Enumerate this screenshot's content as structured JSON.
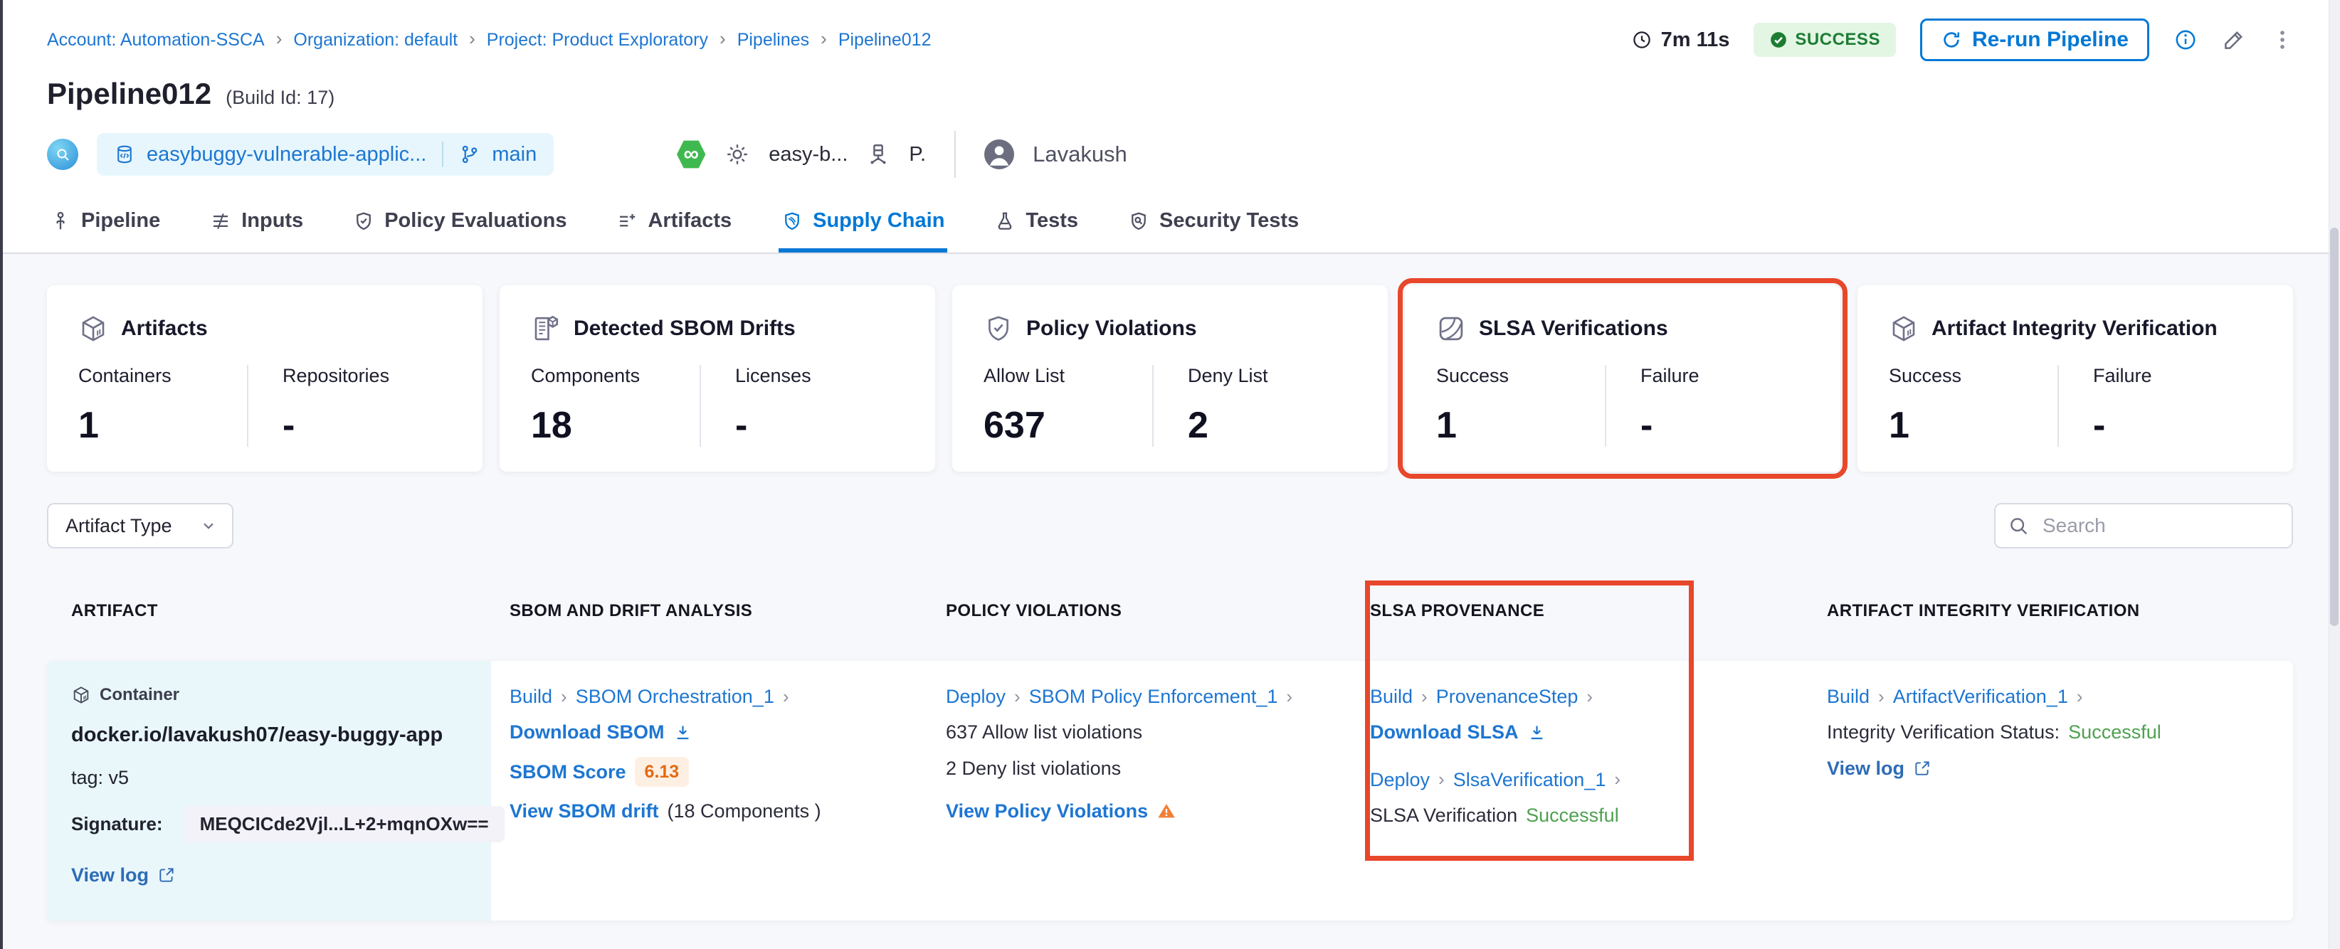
{
  "breadcrumb": {
    "items": [
      "Account: Automation-SSCA",
      "Organization: default",
      "Project: Product Exploratory",
      "Pipelines",
      "Pipeline012"
    ]
  },
  "topbar": {
    "duration": "7m 11s",
    "status": "SUCCESS",
    "rerun_label": "Re-run Pipeline"
  },
  "header": {
    "title": "Pipeline012",
    "build_id": "(Build Id: 17)",
    "repo_name": "easybuggy-vulnerable-applic...",
    "branch": "main",
    "trigger_name": "easy-b...",
    "env_short": "P.",
    "user": "Lavakush"
  },
  "tabs": [
    {
      "label": "Pipeline"
    },
    {
      "label": "Inputs"
    },
    {
      "label": "Policy Evaluations"
    },
    {
      "label": "Artifacts"
    },
    {
      "label": "Supply Chain",
      "active": true
    },
    {
      "label": "Tests"
    },
    {
      "label": "Security Tests"
    }
  ],
  "summary_cards": [
    {
      "title": "Artifacts",
      "icon": "cube-icon",
      "stats": [
        {
          "label": "Containers",
          "value": "1"
        },
        {
          "label": "Repositories",
          "value": "-"
        }
      ]
    },
    {
      "title": "Detected SBOM Drifts",
      "icon": "sbom-document-icon",
      "stats": [
        {
          "label": "Components",
          "value": "18"
        },
        {
          "label": "Licenses",
          "value": "-"
        }
      ]
    },
    {
      "title": "Policy Violations",
      "icon": "shield-check-icon",
      "stats": [
        {
          "label": "Allow List",
          "value": "637"
        },
        {
          "label": "Deny List",
          "value": "2"
        }
      ]
    },
    {
      "title": "SLSA Verifications",
      "icon": "slsa-icon",
      "highlighted": true,
      "stats": [
        {
          "label": "Success",
          "value": "1"
        },
        {
          "label": "Failure",
          "value": "-"
        }
      ]
    },
    {
      "title": "Artifact Integrity Verification",
      "icon": "cube-icon",
      "stats": [
        {
          "label": "Success",
          "value": "1"
        },
        {
          "label": "Failure",
          "value": "-"
        }
      ]
    }
  ],
  "filters": {
    "artifact_type_label": "Artifact Type",
    "search_placeholder": "Search"
  },
  "table": {
    "headers": [
      "ARTIFACT",
      "SBOM AND DRIFT ANALYSIS",
      "POLICY VIOLATIONS",
      "SLSA PROVENANCE",
      "ARTIFACT INTEGRITY VERIFICATION"
    ],
    "row": {
      "artifact": {
        "type_label": "Container",
        "image": "docker.io/lavakush07/easy-buggy-app",
        "tag": "tag: v5",
        "signature_label": "Signature:",
        "signature_value": "MEQCICde2Vjl...L+2+mqnOXw==",
        "view_log": "View log"
      },
      "sbom": {
        "stage": "Build",
        "step": "SBOM Orchestration_1",
        "download": "Download SBOM",
        "score_label": "SBOM Score",
        "score": "6.13",
        "drift_link": "View SBOM drift",
        "drift_suffix": "(18 Components )"
      },
      "policy": {
        "stage": "Deploy",
        "step": "SBOM Policy Enforcement_1",
        "allow": "637 Allow list violations",
        "deny": "2 Deny list violations",
        "view": "View Policy Violations"
      },
      "slsa": {
        "stage1": "Build",
        "step1": "ProvenanceStep",
        "download": "Download SLSA",
        "stage2": "Deploy",
        "step2": "SlsaVerification_1",
        "status_label": "SLSA Verification",
        "status_value": "Successful"
      },
      "integrity": {
        "stage": "Build",
        "step": "ArtifactVerification_1",
        "status_label": "Integrity Verification Status:",
        "status_value": "Successful",
        "view_log": "View log"
      }
    }
  },
  "colors": {
    "annotation_red": "#e8472b",
    "link_blue": "#1d76d2",
    "accent_blue": "#0278d5",
    "success_green": "#4ea14f",
    "success_badge_bg": "#e3f6e4",
    "success_badge_text": "#1d7d33",
    "score_badge_bg": "#fdf0e3",
    "score_badge_text": "#e56910",
    "artifact_cell_bg": "#e9f7fb"
  },
  "icons": [
    "clock-icon",
    "check-circle-icon",
    "refresh-icon",
    "info-icon",
    "edit-pencil-icon",
    "kebab-menu-icon",
    "repository-icon",
    "branch-icon",
    "gear-icon",
    "infra-icon",
    "avatar-icon",
    "search-icon",
    "chevron-down-icon",
    "download-icon",
    "external-link-icon",
    "warning-icon"
  ]
}
